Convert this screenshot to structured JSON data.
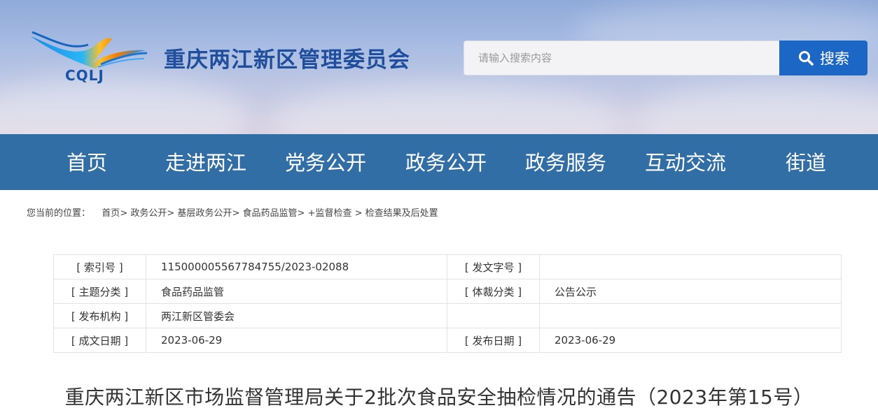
{
  "header": {
    "logo_text": "CQLJ",
    "site_title": "重庆两江新区管理委员会",
    "search": {
      "placeholder": "请输入搜索内容",
      "button_label": "搜索"
    }
  },
  "nav": {
    "items": [
      "首页",
      "走进两江",
      "党务公开",
      "政务公开",
      "政务服务",
      "互动交流",
      "街道"
    ]
  },
  "breadcrumb": {
    "prefix": "您当前的位置：",
    "items": [
      "首页",
      "政务公开",
      "基层政务公开",
      "食品药品监管",
      "+监督检查",
      "检查结果及后处置"
    ],
    "separators": [
      ">",
      ">",
      ">",
      ">",
      ">"
    ]
  },
  "meta_table": {
    "rows": [
      {
        "label1": "[ 索引号 ]",
        "value1": "115000005567784755/2023-02088",
        "label2": "[ 发文字号 ]",
        "value2": ""
      },
      {
        "label1": "[ 主题分类 ]",
        "value1": "食品药品监管",
        "label2": "[ 体裁分类 ]",
        "value2": "公告公示"
      },
      {
        "label1": "[ 发布机构 ]",
        "value1": "两江新区管委会",
        "label2": "",
        "value2": ""
      },
      {
        "label1": "[ 成文日期 ]",
        "value1": "2023-06-29",
        "label2": "[ 发布日期 ]",
        "value2": "2023-06-29"
      }
    ]
  },
  "article": {
    "title": "重庆两江新区市场监督管理局关于2批次食品安全抽检情况的通告（2023年第15号）"
  },
  "colors": {
    "nav_bg": "#316ea6",
    "search_button": "#1c67c6",
    "title_blue": "#1f4e9c"
  }
}
